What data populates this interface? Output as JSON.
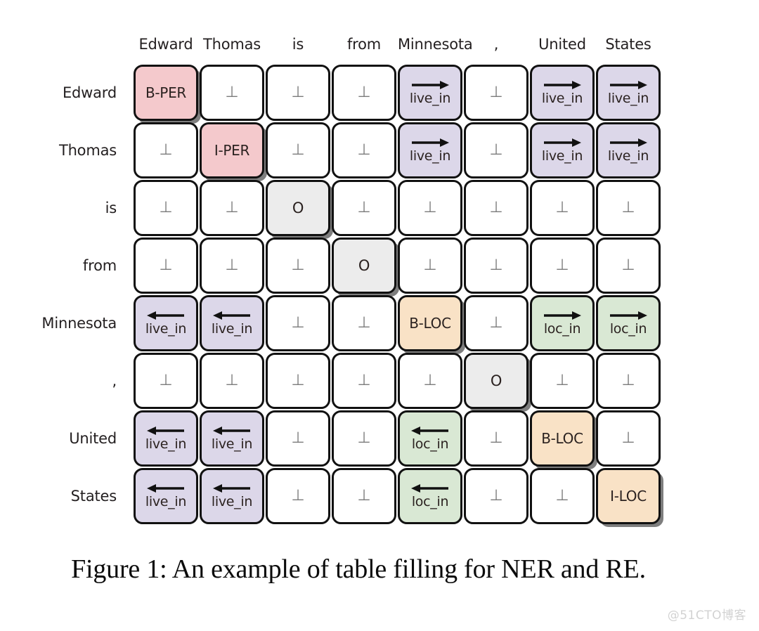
{
  "figure": {
    "caption": "Figure 1: An example of table filling for NER and RE.",
    "watermark": "@51CTO博客",
    "null_symbol": "⊥"
  },
  "colors": {
    "person": "#f4c9cc",
    "location": "#f9e2c6",
    "outside": "#ececec",
    "live_in": "#dcd7e9",
    "loc_in": "#d9e8d4",
    "empty": "#ffffff",
    "border": "#111111",
    "text": "#2b2220",
    "null_text": "#7b7b7b"
  },
  "table": {
    "tokens": [
      "Edward",
      "Thomas",
      "is",
      "from",
      "Minnesota",
      ",",
      "United",
      "States"
    ],
    "column_headers": [
      "Edward",
      "Thomas",
      "is",
      "from",
      "Minnesota",
      ",",
      "United",
      "States"
    ],
    "row_headers": [
      "Edward",
      "Thomas",
      "is",
      "from",
      "Minnesota",
      ",",
      "United",
      "States"
    ],
    "rows": [
      {
        "label": "Edward",
        "cells": [
          {
            "text": "B-PER",
            "kind": "ner",
            "color": "pink",
            "arrow": "none"
          },
          {
            "text": "⊥",
            "kind": "null",
            "color": "white",
            "arrow": "none"
          },
          {
            "text": "⊥",
            "kind": "null",
            "color": "white",
            "arrow": "none"
          },
          {
            "text": "⊥",
            "kind": "null",
            "color": "white",
            "arrow": "none"
          },
          {
            "text": "live_in",
            "kind": "rel",
            "color": "purple",
            "arrow": "right"
          },
          {
            "text": "⊥",
            "kind": "null",
            "color": "white",
            "arrow": "none"
          },
          {
            "text": "live_in",
            "kind": "rel",
            "color": "purple",
            "arrow": "right"
          },
          {
            "text": "live_in",
            "kind": "rel",
            "color": "purple",
            "arrow": "right"
          }
        ]
      },
      {
        "label": "Thomas",
        "cells": [
          {
            "text": "⊥",
            "kind": "null",
            "color": "white",
            "arrow": "none"
          },
          {
            "text": "I-PER",
            "kind": "ner",
            "color": "pink",
            "arrow": "none"
          },
          {
            "text": "⊥",
            "kind": "null",
            "color": "white",
            "arrow": "none"
          },
          {
            "text": "⊥",
            "kind": "null",
            "color": "white",
            "arrow": "none"
          },
          {
            "text": "live_in",
            "kind": "rel",
            "color": "purple",
            "arrow": "right"
          },
          {
            "text": "⊥",
            "kind": "null",
            "color": "white",
            "arrow": "none"
          },
          {
            "text": "live_in",
            "kind": "rel",
            "color": "purple",
            "arrow": "right"
          },
          {
            "text": "live_in",
            "kind": "rel",
            "color": "purple",
            "arrow": "right"
          }
        ]
      },
      {
        "label": "is",
        "cells": [
          {
            "text": "⊥",
            "kind": "null",
            "color": "white",
            "arrow": "none"
          },
          {
            "text": "⊥",
            "kind": "null",
            "color": "white",
            "arrow": "none"
          },
          {
            "text": "O",
            "kind": "ner",
            "color": "gray",
            "arrow": "none"
          },
          {
            "text": "⊥",
            "kind": "null",
            "color": "white",
            "arrow": "none"
          },
          {
            "text": "⊥",
            "kind": "null",
            "color": "white",
            "arrow": "none"
          },
          {
            "text": "⊥",
            "kind": "null",
            "color": "white",
            "arrow": "none"
          },
          {
            "text": "⊥",
            "kind": "null",
            "color": "white",
            "arrow": "none"
          },
          {
            "text": "⊥",
            "kind": "null",
            "color": "white",
            "arrow": "none"
          }
        ]
      },
      {
        "label": "from",
        "cells": [
          {
            "text": "⊥",
            "kind": "null",
            "color": "white",
            "arrow": "none"
          },
          {
            "text": "⊥",
            "kind": "null",
            "color": "white",
            "arrow": "none"
          },
          {
            "text": "⊥",
            "kind": "null",
            "color": "white",
            "arrow": "none"
          },
          {
            "text": "O",
            "kind": "ner",
            "color": "gray",
            "arrow": "none"
          },
          {
            "text": "⊥",
            "kind": "null",
            "color": "white",
            "arrow": "none"
          },
          {
            "text": "⊥",
            "kind": "null",
            "color": "white",
            "arrow": "none"
          },
          {
            "text": "⊥",
            "kind": "null",
            "color": "white",
            "arrow": "none"
          },
          {
            "text": "⊥",
            "kind": "null",
            "color": "white",
            "arrow": "none"
          }
        ]
      },
      {
        "label": "Minnesota",
        "cells": [
          {
            "text": "live_in",
            "kind": "rel",
            "color": "purple",
            "arrow": "left"
          },
          {
            "text": "live_in",
            "kind": "rel",
            "color": "purple",
            "arrow": "left"
          },
          {
            "text": "⊥",
            "kind": "null",
            "color": "white",
            "arrow": "none"
          },
          {
            "text": "⊥",
            "kind": "null",
            "color": "white",
            "arrow": "none"
          },
          {
            "text": "B-LOC",
            "kind": "ner",
            "color": "orange",
            "arrow": "none"
          },
          {
            "text": "⊥",
            "kind": "null",
            "color": "white",
            "arrow": "none"
          },
          {
            "text": "loc_in",
            "kind": "rel",
            "color": "green",
            "arrow": "right"
          },
          {
            "text": "loc_in",
            "kind": "rel",
            "color": "green",
            "arrow": "right"
          }
        ]
      },
      {
        "label": ",",
        "cells": [
          {
            "text": "⊥",
            "kind": "null",
            "color": "white",
            "arrow": "none"
          },
          {
            "text": "⊥",
            "kind": "null",
            "color": "white",
            "arrow": "none"
          },
          {
            "text": "⊥",
            "kind": "null",
            "color": "white",
            "arrow": "none"
          },
          {
            "text": "⊥",
            "kind": "null",
            "color": "white",
            "arrow": "none"
          },
          {
            "text": "⊥",
            "kind": "null",
            "color": "white",
            "arrow": "none"
          },
          {
            "text": "O",
            "kind": "ner",
            "color": "gray",
            "arrow": "none"
          },
          {
            "text": "⊥",
            "kind": "null",
            "color": "white",
            "arrow": "none"
          },
          {
            "text": "⊥",
            "kind": "null",
            "color": "white",
            "arrow": "none"
          }
        ]
      },
      {
        "label": "United",
        "cells": [
          {
            "text": "live_in",
            "kind": "rel",
            "color": "purple",
            "arrow": "left"
          },
          {
            "text": "live_in",
            "kind": "rel",
            "color": "purple",
            "arrow": "left"
          },
          {
            "text": "⊥",
            "kind": "null",
            "color": "white",
            "arrow": "none"
          },
          {
            "text": "⊥",
            "kind": "null",
            "color": "white",
            "arrow": "none"
          },
          {
            "text": "loc_in",
            "kind": "rel",
            "color": "green",
            "arrow": "left"
          },
          {
            "text": "⊥",
            "kind": "null",
            "color": "white",
            "arrow": "none"
          },
          {
            "text": "B-LOC",
            "kind": "ner",
            "color": "orange",
            "arrow": "none"
          },
          {
            "text": "⊥",
            "kind": "null",
            "color": "white",
            "arrow": "none"
          }
        ]
      },
      {
        "label": "States",
        "cells": [
          {
            "text": "live_in",
            "kind": "rel",
            "color": "purple",
            "arrow": "left"
          },
          {
            "text": "live_in",
            "kind": "rel",
            "color": "purple",
            "arrow": "left"
          },
          {
            "text": "⊥",
            "kind": "null",
            "color": "white",
            "arrow": "none"
          },
          {
            "text": "⊥",
            "kind": "null",
            "color": "white",
            "arrow": "none"
          },
          {
            "text": "loc_in",
            "kind": "rel",
            "color": "green",
            "arrow": "left"
          },
          {
            "text": "⊥",
            "kind": "null",
            "color": "white",
            "arrow": "none"
          },
          {
            "text": "⊥",
            "kind": "null",
            "color": "white",
            "arrow": "none"
          },
          {
            "text": "I-LOC",
            "kind": "ner",
            "color": "orange",
            "arrow": "none"
          }
        ]
      }
    ]
  }
}
